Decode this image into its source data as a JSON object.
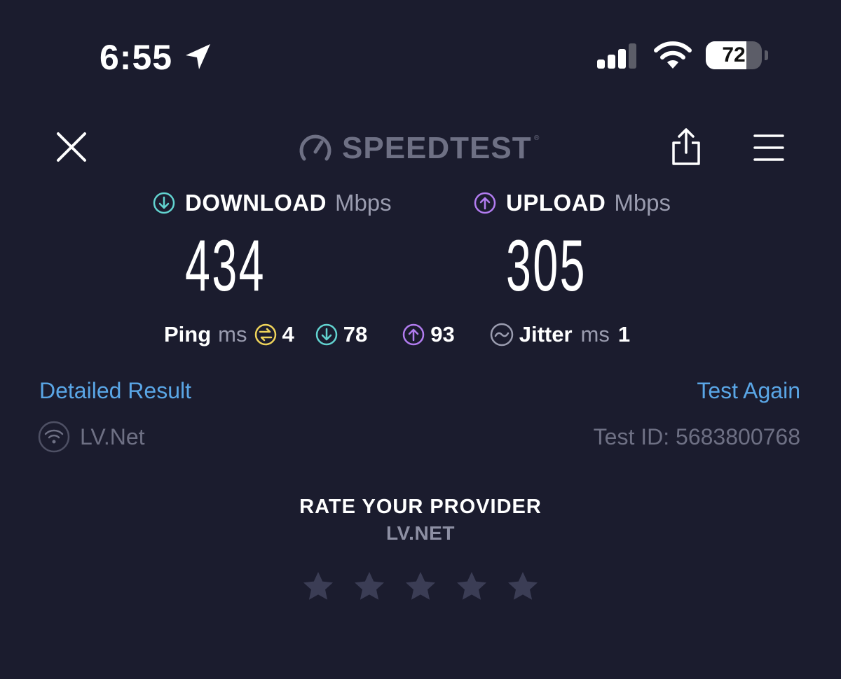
{
  "status_bar": {
    "time": "6:55",
    "battery_text": "72",
    "battery_percent": 72,
    "icons": [
      "location-arrow-icon",
      "cellular-signal-icon",
      "wifi-icon",
      "battery-icon"
    ]
  },
  "header": {
    "logo_text": "SPEEDTEST",
    "logo_mark": "®",
    "icons": [
      "close-icon",
      "speedometer-icon",
      "share-icon",
      "hamburger-menu-icon"
    ]
  },
  "download": {
    "label": "DOWNLOAD",
    "unit": "Mbps",
    "value": "434",
    "icon": "download-arrow-icon",
    "color": "#62d3d0"
  },
  "upload": {
    "label": "UPLOAD",
    "unit": "Mbps",
    "value": "305",
    "icon": "upload-arrow-icon",
    "color": "#b27cf0"
  },
  "ping": {
    "label": "Ping",
    "unit": "ms",
    "idle": "4",
    "download": "78",
    "upload": "93",
    "idle_color": "#efd45a"
  },
  "jitter": {
    "label": "Jitter",
    "unit": "ms",
    "value": "1"
  },
  "links": {
    "detailed_result": "Detailed Result",
    "test_again": "Test Again"
  },
  "provider": {
    "name": "LV.Net",
    "test_id": "Test ID: 5683800768"
  },
  "rating": {
    "title": "RATE YOUR PROVIDER",
    "provider": "LV.NET",
    "stars_total": 5,
    "stars_selected": 0
  },
  "colors": {
    "background": "#1b1c2e",
    "link": "#5aa6e6",
    "dim_text": "#6e7084",
    "star": "#3b3d55"
  }
}
